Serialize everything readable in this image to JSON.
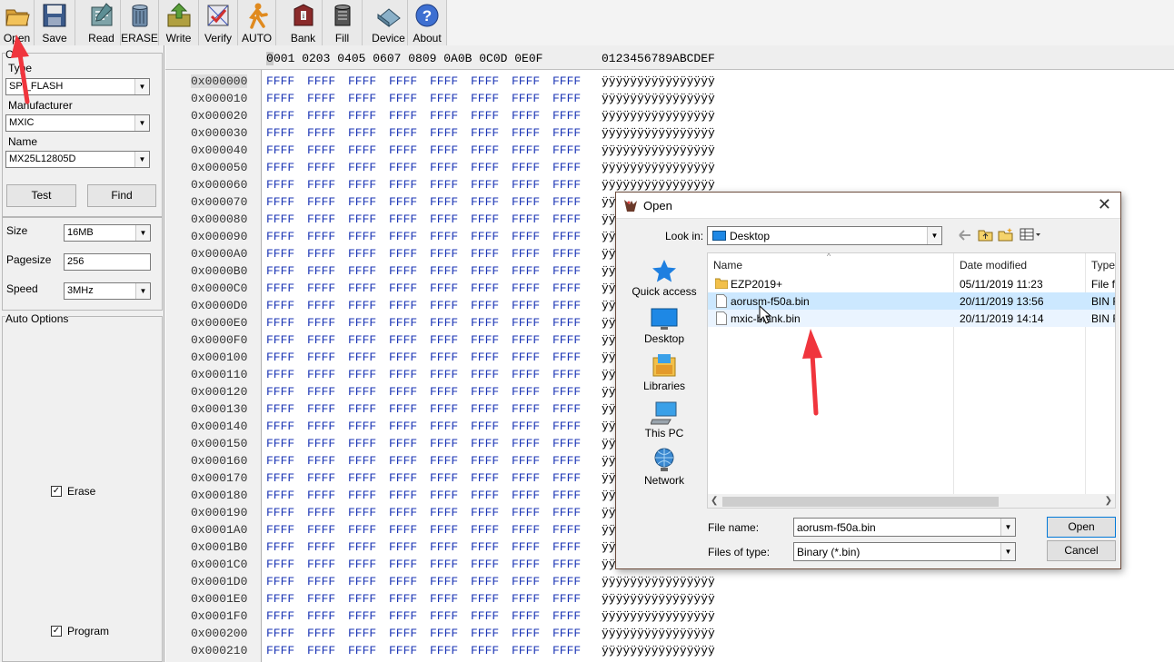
{
  "toolbar": {
    "items": [
      {
        "label": "Open",
        "icon": "folder-open-icon"
      },
      {
        "label": "Save",
        "icon": "floppy-disk-icon"
      },
      {
        "label": "Read",
        "icon": "read-chip-icon"
      },
      {
        "label": "ERASE",
        "icon": "erase-bin-icon"
      },
      {
        "label": "Write",
        "icon": "write-arrow-icon"
      },
      {
        "label": "Verify",
        "icon": "verify-check-icon"
      },
      {
        "label": "AUTO",
        "icon": "auto-runner-icon"
      },
      {
        "label": "Bank",
        "icon": "bank-book-icon"
      },
      {
        "label": "Fill",
        "icon": "fill-bucket-icon"
      },
      {
        "label": "Device",
        "icon": "device-chip-icon"
      },
      {
        "label": "About",
        "icon": "about-question-icon"
      }
    ]
  },
  "left_panel": {
    "chip_group_label": "C",
    "type_label": "Type",
    "type_value": "SPI_FLASH",
    "manufacturer_label": "Manufacturer",
    "manufacturer_value": "MXIC",
    "name_label": "Name",
    "name_value": "MX25L12805D",
    "test_button": "Test",
    "find_button": "Find",
    "size_label": "Size",
    "size_value": "16MB",
    "pagesize_label": "Pagesize",
    "pagesize_value": "256",
    "speed_label": "Speed",
    "speed_value": "3MHz",
    "auto_options_label": "Auto Options",
    "erase_label": "Erase",
    "erase_checked": "✓",
    "program_label": "Program",
    "program_checked": "✓"
  },
  "hex": {
    "header_first": "0",
    "header_rest": "001 0203 0405 0607 0809 0A0B 0C0D 0E0F",
    "header_ascii": "0123456789ABCDEF",
    "word": "FFFF",
    "ascii_full": "ÿÿÿÿÿÿÿÿÿÿÿÿÿÿÿÿ",
    "ascii_partial": "ÿÿ",
    "addresses": [
      "0x000000",
      "0x000010",
      "0x000020",
      "0x000030",
      "0x000040",
      "0x000050",
      "0x000060",
      "0x000070",
      "0x000080",
      "0x000090",
      "0x0000A0",
      "0x0000B0",
      "0x0000C0",
      "0x0000D0",
      "0x0000E0",
      "0x0000F0",
      "0x000100",
      "0x000110",
      "0x000120",
      "0x000130",
      "0x000140",
      "0x000150",
      "0x000160",
      "0x000170",
      "0x000180",
      "0x000190",
      "0x0001A0",
      "0x0001B0",
      "0x0001C0",
      "0x0001D0",
      "0x0001E0",
      "0x0001F0",
      "0x000200",
      "0x000210"
    ]
  },
  "dialog": {
    "title": "Open",
    "close_glyph": "✕",
    "look_in_label": "Look in:",
    "look_in_value": "Desktop",
    "places": [
      {
        "label": "Quick access",
        "icon": "quick-access-star-icon"
      },
      {
        "label": "Desktop",
        "icon": "desktop-icon"
      },
      {
        "label": "Libraries",
        "icon": "libraries-icon"
      },
      {
        "label": "This PC",
        "icon": "this-pc-icon"
      },
      {
        "label": "Network",
        "icon": "network-icon"
      }
    ],
    "columns": {
      "name": "Name",
      "date": "Date modified",
      "type": "Type"
    },
    "files": [
      {
        "name": "EZP2019+",
        "date": "05/11/2019 11:23",
        "type": "File fo",
        "kind": "folder"
      },
      {
        "name": "aorusm-f50a.bin",
        "date": "20/11/2019 13:56",
        "type": "BIN F",
        "kind": "file",
        "selected": true
      },
      {
        "name": "mxic-blank.bin",
        "date": "20/11/2019 14:14",
        "type": "BIN F",
        "kind": "file"
      }
    ],
    "file_name_label": "File name:",
    "file_name_value": "aorusm-f50a.bin",
    "files_of_type_label": "Files of type:",
    "files_of_type_value": "Binary (*.bin)",
    "open_button": "Open",
    "cancel_button": "Cancel"
  },
  "colors": {
    "hex_blue": "#1b35b5",
    "selection": "#cce8ff",
    "annotation_red": "#f0353d"
  }
}
